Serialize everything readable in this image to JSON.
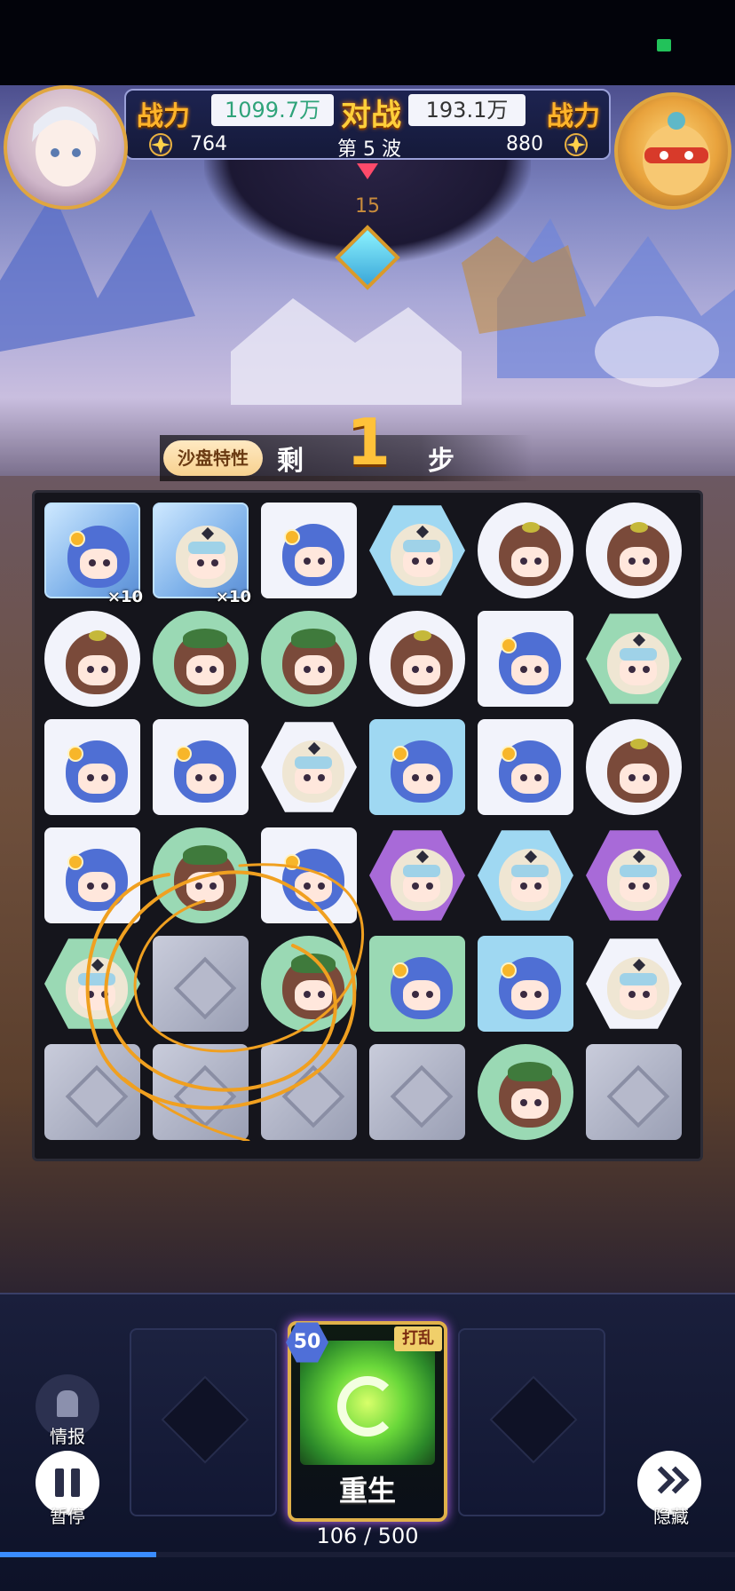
{
  "hud": {
    "player_power_label": "战力",
    "player_power_value": "1099.7万",
    "vs_label": "对战",
    "enemy_power_value": "193.1万",
    "enemy_power_label": "战力",
    "player_score": "764",
    "wave_label": "第 5 波",
    "enemy_score": "880",
    "turn_number": "15"
  },
  "steps": {
    "tag": "沙盘特性",
    "prefix": "剩",
    "count": "1",
    "suffix": "步"
  },
  "board": {
    "rows": 6,
    "cols": 6,
    "cells": [
      [
        {
          "piece": "blue-hair-hero",
          "bg": "ice",
          "shape": "square",
          "badge": "×10"
        },
        {
          "piece": "veil-hero",
          "bg": "ice",
          "shape": "square",
          "badge": "×10"
        },
        {
          "piece": "blue-hair-hero",
          "bg": "white",
          "shape": "square"
        },
        {
          "piece": "veil-hero",
          "bg": "blue",
          "shape": "hex"
        },
        {
          "piece": "brown-hair-hero",
          "bg": "white",
          "shape": "circle"
        },
        {
          "piece": "brown-hair-hero",
          "bg": "white",
          "shape": "circle"
        }
      ],
      [
        {
          "piece": "brown-hair-hero",
          "bg": "white",
          "shape": "circle"
        },
        {
          "piece": "green-hat-hero",
          "bg": "green",
          "shape": "circle"
        },
        {
          "piece": "green-hat-hero",
          "bg": "green",
          "shape": "circle"
        },
        {
          "piece": "brown-hair-hero",
          "bg": "white",
          "shape": "circle"
        },
        {
          "piece": "blue-hair-hero",
          "bg": "white",
          "shape": "square"
        },
        {
          "piece": "veil-hero",
          "bg": "green",
          "shape": "hex"
        }
      ],
      [
        {
          "piece": "blue-hair-hero",
          "bg": "white",
          "shape": "square"
        },
        {
          "piece": "blue-hair-hero",
          "bg": "white",
          "shape": "square"
        },
        {
          "piece": "veil-hero",
          "bg": "white",
          "shape": "hex"
        },
        {
          "piece": "blue-hair-hero",
          "bg": "blue",
          "shape": "square"
        },
        {
          "piece": "blue-hair-hero",
          "bg": "white",
          "shape": "square"
        },
        {
          "piece": "brown-hair-hero",
          "bg": "white",
          "shape": "circle"
        }
      ],
      [
        {
          "piece": "blue-hair-hero",
          "bg": "white",
          "shape": "square"
        },
        {
          "piece": "green-hat-hero",
          "bg": "green",
          "shape": "circle"
        },
        {
          "piece": "blue-hair-hero",
          "bg": "white",
          "shape": "square"
        },
        {
          "piece": "veil-hero",
          "bg": "purple",
          "shape": "hex"
        },
        {
          "piece": "veil-hero",
          "bg": "blue",
          "shape": "hex"
        },
        {
          "piece": "veil-hero",
          "bg": "purple",
          "shape": "hex"
        }
      ],
      [
        {
          "piece": "veil-hero",
          "bg": "green",
          "shape": "hex"
        },
        {
          "piece": "stone-block",
          "bg": "stone",
          "shape": "square"
        },
        {
          "piece": "green-hat-hero",
          "bg": "green",
          "shape": "circle"
        },
        {
          "piece": "blue-hair-hero",
          "bg": "green",
          "shape": "square"
        },
        {
          "piece": "blue-hair-hero",
          "bg": "blue",
          "shape": "square"
        },
        {
          "piece": "veil-hero",
          "bg": "white",
          "shape": "hex"
        }
      ],
      [
        {
          "piece": "stone-block",
          "bg": "stone",
          "shape": "square"
        },
        {
          "piece": "stone-block",
          "bg": "stone",
          "shape": "square"
        },
        {
          "piece": "stone-block",
          "bg": "stone",
          "shape": "square"
        },
        {
          "piece": "stone-block",
          "bg": "stone",
          "shape": "square"
        },
        {
          "piece": "green-hat-hero",
          "bg": "green",
          "shape": "circle"
        },
        {
          "piece": "stone-block",
          "bg": "stone",
          "shape": "square"
        }
      ]
    ]
  },
  "controls": {
    "intel_label": "情报",
    "pause_label": "暂停",
    "hide_label": "隐藏"
  },
  "skill": {
    "cost": "50",
    "tag": "打乱",
    "name": "重生",
    "energy_text": "106 / 500",
    "energy_fraction": 0.212
  },
  "colors": {
    "power_label": "#ffb42a",
    "player_power": "#2fa37a",
    "annotation_stroke": "#f0a020"
  }
}
